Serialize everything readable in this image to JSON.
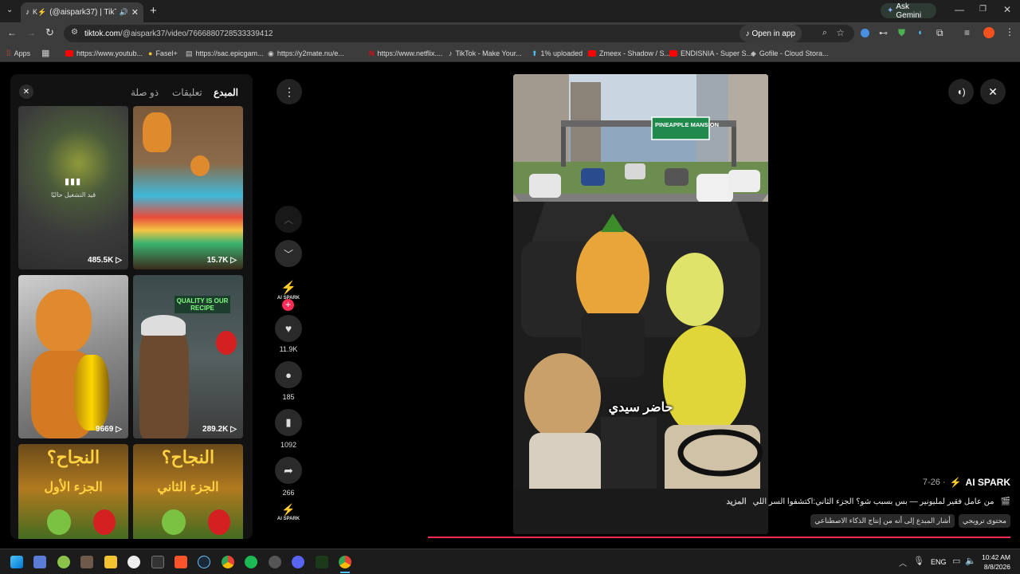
{
  "browser": {
    "tab_title": "(@aispark37) | TikTok",
    "tab_prefix": "K⚡",
    "url_host": "tiktok.com",
    "url_path": "/@aispark37/video/7666880728533339412",
    "open_in_app": "Open in app",
    "ask_gemini": "Ask Gemini"
  },
  "bookmarks": [
    {
      "label": "Apps",
      "color": "#ea4335"
    },
    {
      "label": "https://www.youtub...",
      "color": "#ff0000"
    },
    {
      "label": "Fasel+",
      "color": "#f4c430"
    },
    {
      "label": "https://sac.epicgam...",
      "color": "#cccccc"
    },
    {
      "label": "https://y2mate.nu/e...",
      "color": "#e53935"
    },
    {
      "label": "https://www.netflix....",
      "color": "#e50914"
    },
    {
      "label": "TikTok - Make Your...",
      "color": "#ffffff"
    },
    {
      "label": "1% uploaded",
      "color": "#4fc3f7"
    },
    {
      "label": "Zmeex - Shadow / S...",
      "color": "#ff0000"
    },
    {
      "label": "ENDISNIA - Super S...",
      "color": "#ff0000"
    },
    {
      "label": "Gofile - Cloud Stora...",
      "color": "#bbbbbb"
    }
  ],
  "panel": {
    "tabs": [
      "ذو صلة",
      "تعليقات",
      "المبدع"
    ],
    "now_playing": "قيد التشغيل حاليًا",
    "thumbs": [
      {
        "count": "485.5K"
      },
      {
        "count": "15.7K"
      },
      {
        "count": "9669"
      },
      {
        "count": "289.2K"
      },
      {
        "count": ""
      },
      {
        "count": ""
      }
    ],
    "thumb_texts": [
      "النجاح؟",
      "الجزء الأول",
      "النجاح؟",
      "الجزء الثاني",
      "QUALITY IS OUR RECIPE"
    ]
  },
  "rail": {
    "avatar_label": "AI SPARK",
    "likes": "11.9K",
    "comments": "185",
    "saves": "1092",
    "shares": "266",
    "bottom_label": "AI SPARK"
  },
  "video": {
    "road_sign": "PINEAPPLE MANSION",
    "subtitle": "حاضر سيدي"
  },
  "info": {
    "author": "AI SPARK",
    "date": "7-26 ·",
    "description": "من عامل فقير لمليونير — بس بسبب شو؟ الجزء الثاني:اكتشفوا السر اللي",
    "more": "المزيد",
    "tag_promo": "محتوى ترويجي",
    "tag_ai": "أشار المبدع إلى أنه من إنتاج الذكاء الاصطناعي"
  },
  "taskbar": {
    "lang": "ENG",
    "time": "10:42 AM",
    "date": "8/8/2026"
  },
  "colors": {
    "accent": "#fe2c55",
    "panel": "#121212",
    "page": "#000000"
  }
}
